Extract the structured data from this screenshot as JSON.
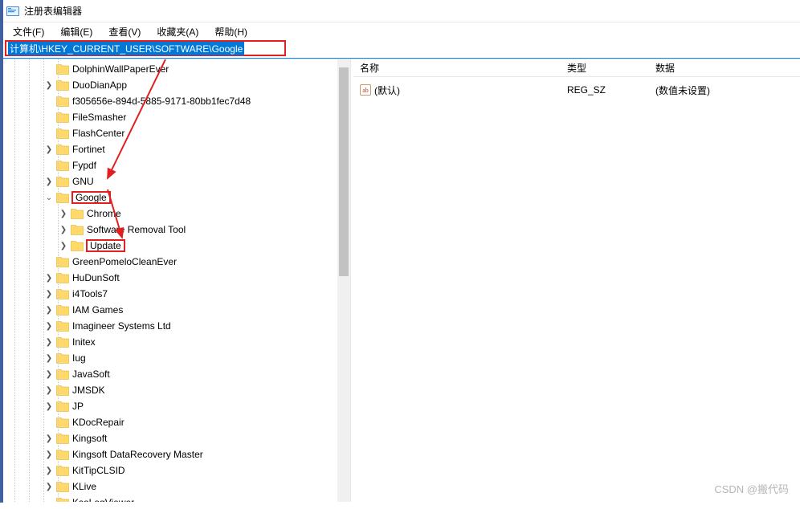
{
  "window": {
    "title": "注册表编辑器"
  },
  "menubar": {
    "file": "文件(F)",
    "edit": "编辑(E)",
    "view": "查看(V)",
    "favorites": "收藏夹(A)",
    "help": "帮助(H)"
  },
  "addressbar": {
    "path": "计算机\\HKEY_CURRENT_USER\\SOFTWARE\\Google"
  },
  "tree": {
    "items": [
      {
        "label": "DolphinWallPaperEver",
        "depth": 3,
        "exp": "blank"
      },
      {
        "label": "DuoDianApp",
        "depth": 3,
        "exp": ">"
      },
      {
        "label": "f305656e-894d-5885-9171-80bb1fec7d48",
        "depth": 3,
        "exp": "blank"
      },
      {
        "label": "FileSmasher",
        "depth": 3,
        "exp": "blank"
      },
      {
        "label": "FlashCenter",
        "depth": 3,
        "exp": "blank"
      },
      {
        "label": "Fortinet",
        "depth": 3,
        "exp": ">"
      },
      {
        "label": "Fypdf",
        "depth": 3,
        "exp": "blank"
      },
      {
        "label": "GNU",
        "depth": 3,
        "exp": ">"
      },
      {
        "label": "Google",
        "depth": 3,
        "exp": "v",
        "highlight": true
      },
      {
        "label": "Chrome",
        "depth": 4,
        "exp": ">"
      },
      {
        "label": "Software Removal Tool",
        "depth": 4,
        "exp": ">"
      },
      {
        "label": "Update",
        "depth": 4,
        "exp": ">",
        "highlight": true
      },
      {
        "label": "GreenPomeloCleanEver",
        "depth": 3,
        "exp": "blank"
      },
      {
        "label": "HuDunSoft",
        "depth": 3,
        "exp": ">"
      },
      {
        "label": "i4Tools7",
        "depth": 3,
        "exp": ">"
      },
      {
        "label": "IAM Games",
        "depth": 3,
        "exp": ">"
      },
      {
        "label": "Imagineer Systems Ltd",
        "depth": 3,
        "exp": ">"
      },
      {
        "label": "Initex",
        "depth": 3,
        "exp": ">"
      },
      {
        "label": "Iug",
        "depth": 3,
        "exp": ">"
      },
      {
        "label": "JavaSoft",
        "depth": 3,
        "exp": ">"
      },
      {
        "label": "JMSDK",
        "depth": 3,
        "exp": ">"
      },
      {
        "label": "JP",
        "depth": 3,
        "exp": ">"
      },
      {
        "label": "KDocRepair",
        "depth": 3,
        "exp": "blank"
      },
      {
        "label": "Kingsoft",
        "depth": 3,
        "exp": ">"
      },
      {
        "label": "Kingsoft DataRecovery Master",
        "depth": 3,
        "exp": ">"
      },
      {
        "label": "KitTipCLSID",
        "depth": 3,
        "exp": ">"
      },
      {
        "label": "KLive",
        "depth": 3,
        "exp": ">"
      },
      {
        "label": "KsoLogViewer",
        "depth": 3,
        "exp": "blank"
      }
    ]
  },
  "values": {
    "columns": {
      "name": "名称",
      "type": "类型",
      "data": "数据"
    },
    "rows": [
      {
        "name": "(默认)",
        "type": "REG_SZ",
        "data": "(数值未设置)"
      }
    ]
  },
  "watermark": "CSDN @搬代码"
}
